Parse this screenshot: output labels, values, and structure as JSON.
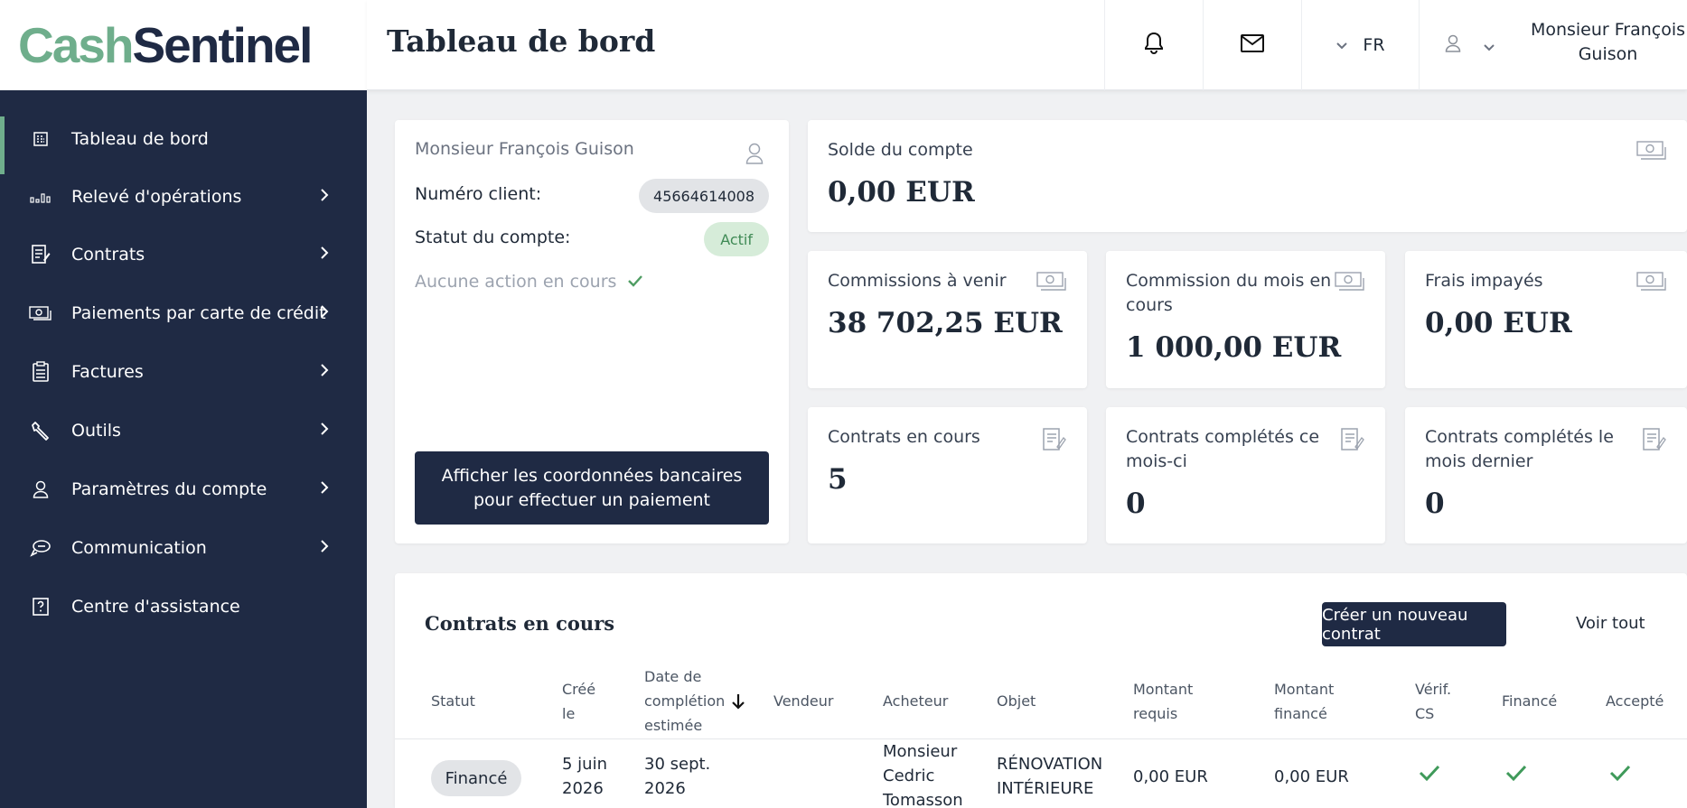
{
  "brand": {
    "part1": "Cash",
    "part2": "Sentinel"
  },
  "header": {
    "title": "Tableau de bord",
    "language": "FR",
    "user_name": "Monsieur François Guison",
    "icons": [
      "bell-icon",
      "mail-icon",
      "chevron-down-icon",
      "user-icon"
    ]
  },
  "sidebar": {
    "items": [
      {
        "label": "Tableau de bord",
        "icon": "dashboard-icon",
        "active": true
      },
      {
        "label": "Relevé d'opérations",
        "icon": "chart-icon"
      },
      {
        "label": "Contrats",
        "icon": "contract-icon"
      },
      {
        "label": "Paiements par carte de crédit",
        "icon": "money-icon"
      },
      {
        "label": "Factures",
        "icon": "invoice-icon"
      },
      {
        "label": "Outils",
        "icon": "wrench-icon"
      },
      {
        "label": "Paramètres du compte",
        "icon": "user-icon"
      },
      {
        "label": "Communication",
        "icon": "chat-icon"
      },
      {
        "label": "Centre d'assistance",
        "icon": "help-icon"
      }
    ]
  },
  "client": {
    "name": "Monsieur François Guison",
    "number_label": "Numéro client:",
    "number": "45664614008",
    "status_label": "Statut du compte:",
    "status": "Actif",
    "no_action": "Aucune action en cours",
    "bank_button": "Afficher les coordonnées bancaires pour effectuer un paiement"
  },
  "stats": {
    "solde": {
      "label": "Solde du compte",
      "value": "0,00 EUR"
    },
    "commissions": {
      "label": "Commissions à venir",
      "value": "38 702,25 EUR"
    },
    "commission_mois": {
      "label": "Commission du mois en cours",
      "value": "1 000,00 EUR"
    },
    "frais": {
      "label": "Frais impayés",
      "value": "0,00 EUR"
    },
    "contrats_cours": {
      "label": "Contrats en cours",
      "value": "5"
    },
    "contrats_mois": {
      "label": "Contrats complétés ce mois-ci",
      "value": "0"
    },
    "contrats_dernier": {
      "label": "Contrats complétés le mois dernier",
      "value": "0"
    }
  },
  "contracts": {
    "title": "Contrats en cours",
    "new_button": "Créer un nouveau contrat",
    "see_all": "Voir tout",
    "columns": {
      "statut": "Statut",
      "cree": "Créé le",
      "date": "Date de complétion estimée",
      "vendeur": "Vendeur",
      "acheteur": "Acheteur",
      "objet": "Objet",
      "montant_requis": "Montant requis",
      "montant_finance": "Montant financé",
      "verif": "Vérif. CS",
      "finance": "Financé",
      "accepte": "Accepté"
    },
    "rows": [
      {
        "statut": "Financé",
        "cree": "5 juin 2026",
        "date": "30 sept. 2026",
        "vendeur": "",
        "acheteur": "Monsieur Cedric Tomasson",
        "objet": "RÉNOVATION INTÉRIEURE",
        "montant_requis": "0,00 EUR",
        "montant_finance": "0,00 EUR",
        "verif": true,
        "finance": true,
        "accepte": true
      }
    ]
  },
  "colors": {
    "navy": "#1f2a44",
    "green": "#6fae8c",
    "check": "#3f9a5a"
  }
}
